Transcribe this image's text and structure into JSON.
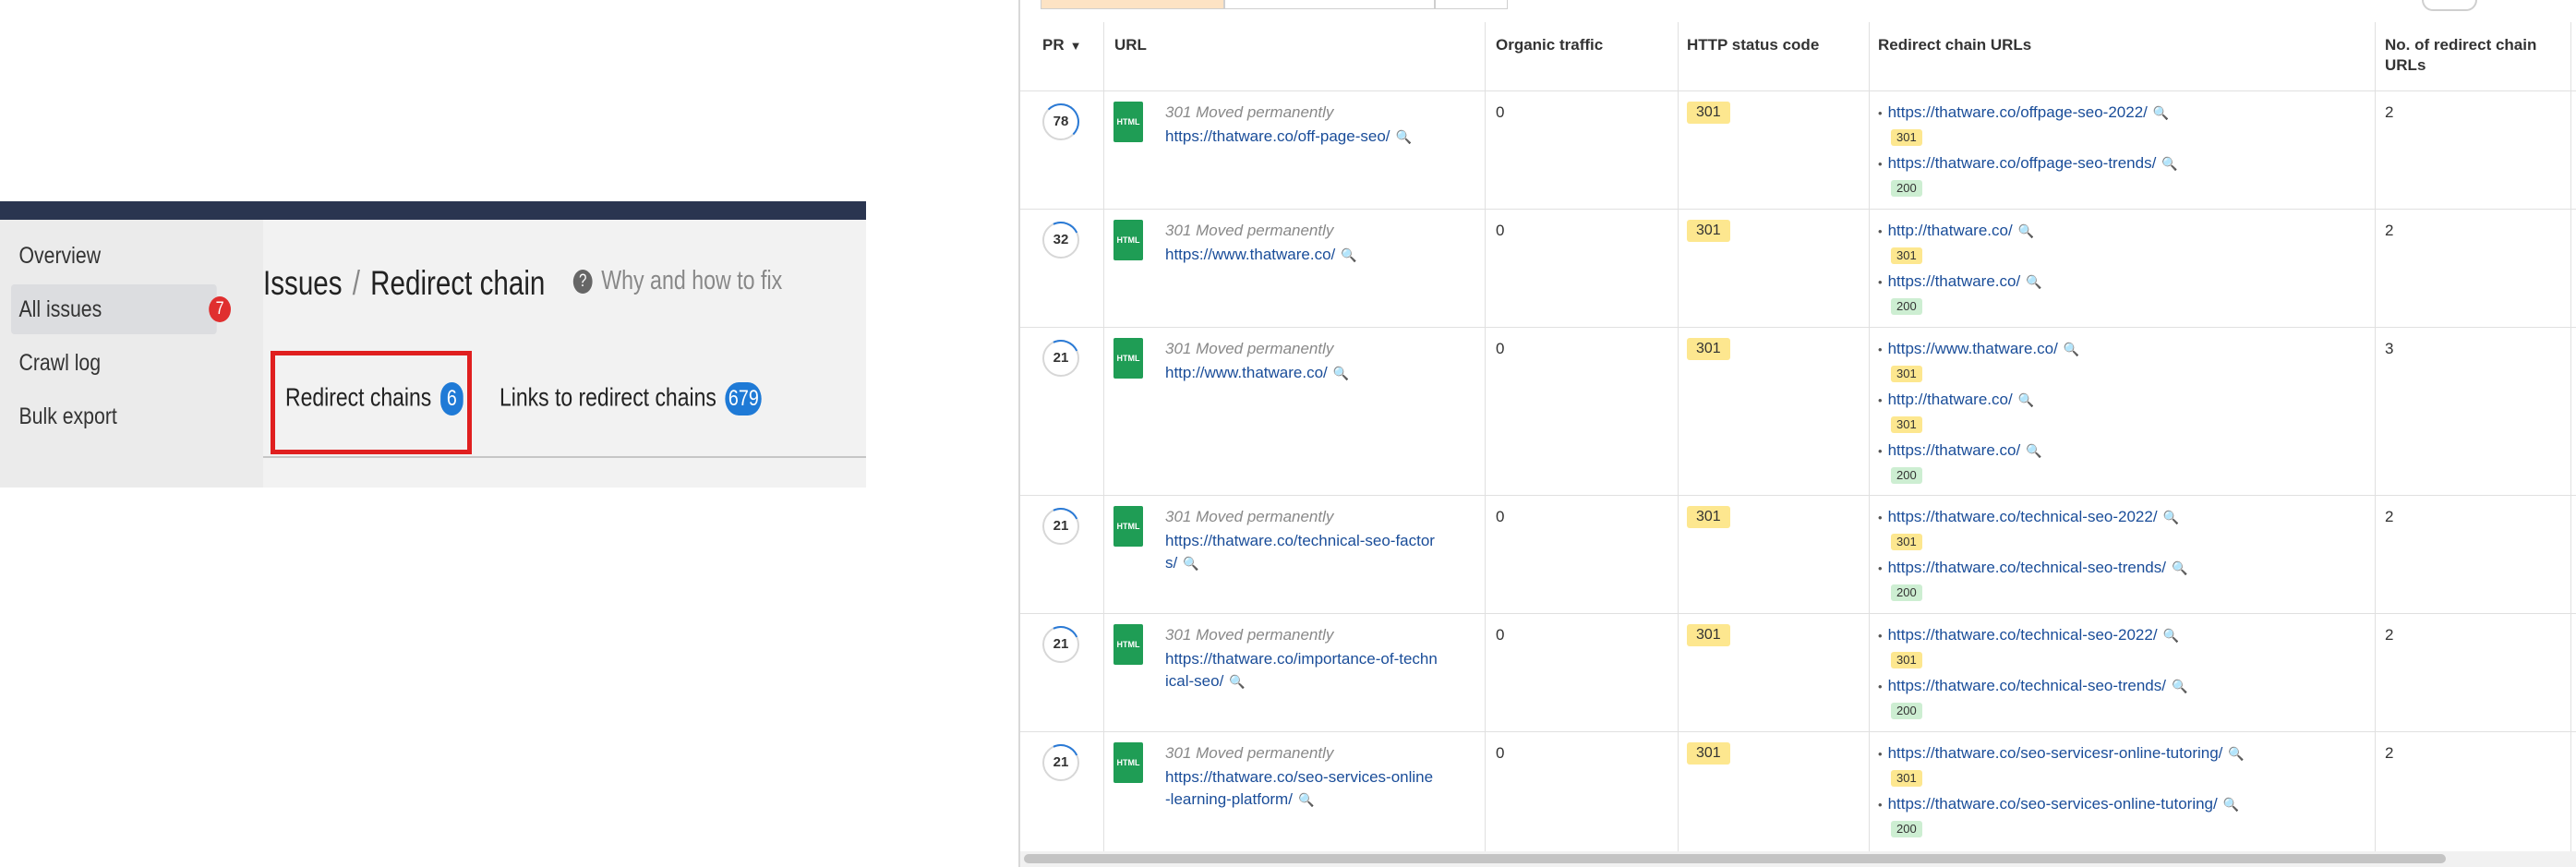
{
  "left": {
    "nav": [
      {
        "label": "Overview"
      },
      {
        "label": "All issues",
        "badge": "7"
      },
      {
        "label": "Crawl log"
      },
      {
        "label": "Bulk export"
      }
    ],
    "breadcrumb": {
      "parent": "Issues",
      "separator": "/",
      "current": "Redirect chain"
    },
    "help": {
      "icon": "?",
      "label": "Why and how to fix"
    },
    "tabs": [
      {
        "label": "Redirect chains",
        "count": "6"
      },
      {
        "label": "Links to redirect chains",
        "count": "679"
      }
    ]
  },
  "table": {
    "headers": {
      "pr": "PR",
      "url": "URL",
      "traffic": "Organic traffic",
      "status": "HTTP status code",
      "chain": "Redirect chain URLs",
      "count": "No. of redirect chain URLs"
    },
    "rows": [
      {
        "pr": "78",
        "status_text": "301 Moved permanently",
        "url": "https://thatware.co/off-page-seo/",
        "traffic": "0",
        "code": "301",
        "chain": [
          {
            "url": "https://thatware.co/offpage-seo-2022/",
            "code": "301"
          },
          {
            "url": "https://thatware.co/offpage-seo-trends/",
            "code": "200"
          }
        ],
        "count": "2"
      },
      {
        "pr": "32",
        "status_text": "301 Moved permanently",
        "url": "https://www.thatware.co/",
        "traffic": "0",
        "code": "301",
        "chain": [
          {
            "url": "http://thatware.co/",
            "code": "301"
          },
          {
            "url": "https://thatware.co/",
            "code": "200"
          }
        ],
        "count": "2"
      },
      {
        "pr": "21",
        "status_text": "301 Moved permanently",
        "url": "http://www.thatware.co/",
        "traffic": "0",
        "code": "301",
        "chain": [
          {
            "url": "https://www.thatware.co/",
            "code": "301"
          },
          {
            "url": "http://thatware.co/",
            "code": "301"
          },
          {
            "url": "https://thatware.co/",
            "code": "200"
          }
        ],
        "count": "3"
      },
      {
        "pr": "21",
        "status_text": "301 Moved permanently",
        "url_line1": "https://thatware.co/technical-seo-factor",
        "url_line2": "s/",
        "traffic": "0",
        "code": "301",
        "chain": [
          {
            "url": "https://thatware.co/technical-seo-2022/",
            "code": "301"
          },
          {
            "url": "https://thatware.co/technical-seo-trends/",
            "code": "200"
          }
        ],
        "count": "2"
      },
      {
        "pr": "21",
        "status_text": "301 Moved permanently",
        "url_line1": "https://thatware.co/importance-of-techn",
        "url_line2": "ical-seo/",
        "traffic": "0",
        "code": "301",
        "chain": [
          {
            "url": "https://thatware.co/technical-seo-2022/",
            "code": "301"
          },
          {
            "url": "https://thatware.co/technical-seo-trends/",
            "code": "200"
          }
        ],
        "count": "2"
      },
      {
        "pr": "21",
        "status_text": "301 Moved permanently",
        "url_line1": "https://thatware.co/seo-services-online",
        "url_line2": "-learning-platform/",
        "traffic": "0",
        "code": "301",
        "chain": [
          {
            "url": "https://thatware.co/seo-servicesr-online-tutoring/",
            "code": "301"
          },
          {
            "url": "https://thatware.co/seo-services-online-tutoring/",
            "code": "200"
          }
        ],
        "count": "2"
      }
    ]
  },
  "icons": {
    "file": "html-file-icon",
    "search": "magnifier-icon",
    "help": "question-icon"
  },
  "colors": {
    "accent": "#1f7ad6",
    "badge_red": "#e02f2f",
    "highlight_border": "#e01f1f",
    "code_301": "#fde78f",
    "code_200": "#cdeed2",
    "link": "#1a4d99",
    "file_icon": "#1f9d55"
  }
}
